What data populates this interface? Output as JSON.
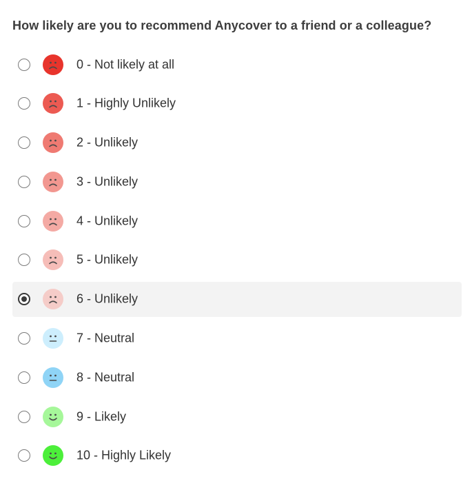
{
  "question": "How likely are you to recommend Anycover to a friend or a colleague?",
  "selected_index": 6,
  "options": [
    {
      "label": "0 - Not likely at all",
      "icon": "sad-face-icon",
      "color": "#e8342c"
    },
    {
      "label": "1 - Highly Unlikely",
      "icon": "sad-face-icon",
      "color": "#ec5a52"
    },
    {
      "label": "2 - Unlikely",
      "icon": "sad-face-icon",
      "color": "#ef7a72"
    },
    {
      "label": "3 - Unlikely",
      "icon": "sad-face-icon",
      "color": "#f29790"
    },
    {
      "label": "4 - Unlikely",
      "icon": "sad-face-icon",
      "color": "#f4aaa4"
    },
    {
      "label": "5 - Unlikely",
      "icon": "sad-face-icon",
      "color": "#f6bdb8"
    },
    {
      "label": "6 - Unlikely",
      "icon": "sad-face-icon",
      "color": "#f5ccc8"
    },
    {
      "label": "7 - Neutral",
      "icon": "neutral-face-icon",
      "color": "#cdeefd"
    },
    {
      "label": "8 - Neutral",
      "icon": "neutral-face-icon",
      "color": "#8fd4f6"
    },
    {
      "label": "9 - Likely",
      "icon": "smile-face-icon",
      "color": "#a6f79a"
    },
    {
      "label": "10 - Highly Likely",
      "icon": "smile-face-icon",
      "color": "#4cef3a"
    }
  ]
}
